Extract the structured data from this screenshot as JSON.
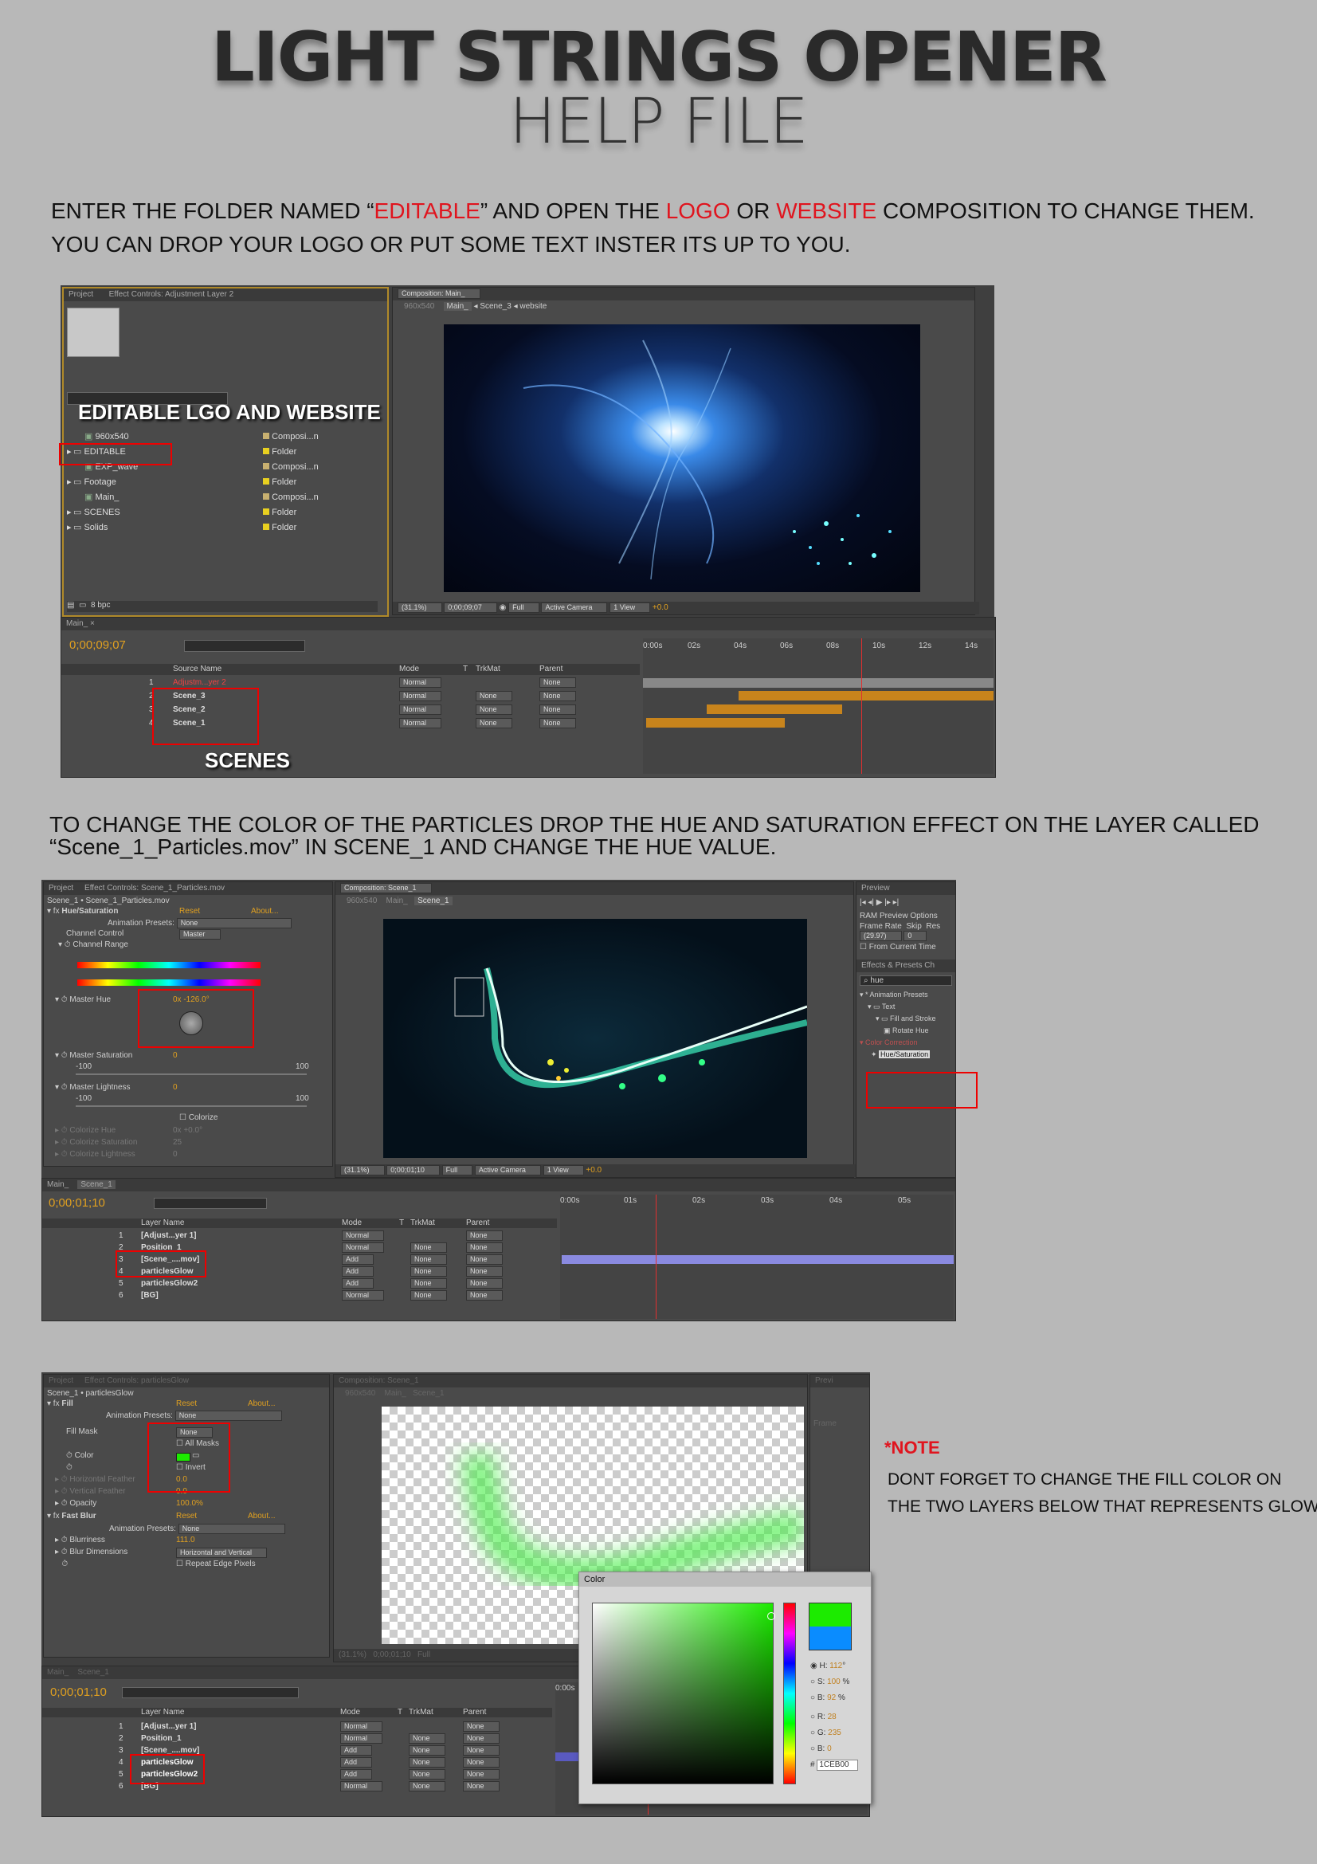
{
  "header": {
    "title": "LIGHT STRINGS OPENER",
    "subtitle": "HELP FILE"
  },
  "instructions": {
    "p1_line1": [
      "ENTER THE FOLDER NAMED “",
      "EDITABLE",
      "” AND OPEN THE  ",
      "LOGO",
      " OR ",
      "WEBSITE",
      " COMPOSITION TO CHANGE THEM."
    ],
    "p1_line2": "YOU CAN DROP YOUR LOGO OR PUT SOME TEXT INSTER ITS UP TO YOU.",
    "p2_line1": "TO CHANGE THE COLOR OF THE PARTICLES DROP THE HUE AND SATURATION EFFECT ON THE LAYER CALLED",
    "p2_line2": "“Scene_1_Particles.mov” IN SCENE_1 AND CHANGE THE HUE VALUE.",
    "note_title": "*NOTE",
    "note_line1": "DONT FORGET TO CHANGE THE FILL COLOR ON",
    "note_line2": "THE TWO LAYERS BELOW THAT REPRESENTS GLOW"
  },
  "shot1": {
    "tab_project": "Project",
    "tab_effect": "Effect Controls: Adjustment Layer 2",
    "overlay_label": "EDITABLE LGO AND WEBSITE",
    "items": [
      {
        "name": "960x540",
        "type": "Composi...n"
      },
      {
        "name": "EDITABLE",
        "type": "Folder"
      },
      {
        "name": "EXP_wave",
        "type": "Composi...n"
      },
      {
        "name": "Footage",
        "type": "Folder"
      },
      {
        "name": "Main_",
        "type": "Composi...n"
      },
      {
        "name": "SCENES",
        "type": "Folder"
      },
      {
        "name": "Solids",
        "type": "Folder"
      }
    ],
    "bpc": "8 bpc",
    "comp_tab": "Composition: Main_",
    "crumbs": [
      "960x540",
      "Main_",
      "Scene_3",
      "website"
    ],
    "zoom": "(31.1%)",
    "timecode_viewer": "0;00;09;07",
    "res": "Full",
    "camera": "Active Camera",
    "view": "1 View",
    "offset": "+0.0",
    "timeline_tab": "Main_",
    "timecode": "0;00;09;07",
    "col_source": "Source Name",
    "col_mode": "Mode",
    "col_t": "T",
    "col_trkmat": "TrkMat",
    "col_parent": "Parent",
    "layers": [
      {
        "num": "1",
        "name": "Adjustm...yer 2",
        "mode": "Normal",
        "trk": "",
        "parent": "None"
      },
      {
        "num": "2",
        "name": "Scene_3",
        "mode": "Normal",
        "trk": "None",
        "parent": "None"
      },
      {
        "num": "3",
        "name": "Scene_2",
        "mode": "Normal",
        "trk": "None",
        "parent": "None"
      },
      {
        "num": "4",
        "name": "Scene_1",
        "mode": "Normal",
        "trk": "None",
        "parent": "None"
      }
    ],
    "ruler": [
      "0:00s",
      "02s",
      "04s",
      "06s",
      "08s",
      "10s",
      "12s",
      "14s"
    ],
    "scenes_label": "SCENES"
  },
  "shot2": {
    "tab_project": "Project",
    "tab_effect": "Effect Controls: Scene_1_Particles.mov",
    "breadcrumb": "Scene_1 • Scene_1_Particles.mov",
    "fx_name": "Hue/Saturation",
    "reset": "Reset",
    "about": "About...",
    "anim_presets": "Animation Presets:",
    "anim_none": "None",
    "channel_control": "Channel Control",
    "channel_value": "Master",
    "channel_range": "Channel Range",
    "master_hue": "Master Hue",
    "master_hue_val": "0x -126.0°",
    "master_sat": "Master Saturation",
    "master_sat_val": "0",
    "master_light": "Master Lightness",
    "master_light_val": "0",
    "min": "-100",
    "max": "100",
    "colorize": "Colorize",
    "colorize_hue": "Colorize Hue",
    "colorize_hue_val": "0x +0.0°",
    "colorize_sat": "Colorize Saturation",
    "colorize_sat_val": "25",
    "colorize_light": "Colorize Lightness",
    "colorize_light_val": "0",
    "comp_tab": "Composition: Scene_1",
    "crumbs": [
      "960x540",
      "Main_",
      "Scene_1"
    ],
    "zoom": "(31.1%)",
    "timecode_viewer": "0;00;01;10",
    "res": "Full",
    "camera": "Active Camera",
    "view": "1 View",
    "offset": "+0.0",
    "preview_tab": "Preview",
    "ram_options": "RAM Preview Options",
    "frame_rate": "Frame Rate",
    "skip": "Skip",
    "res_label": "Res",
    "fr_val": "(29.97)",
    "skip_val": "0",
    "from_current": "From Current Time",
    "effects_tab": "Effects & Presets",
    "ch_tab": "Ch",
    "search_val": "hue",
    "ep_tree": [
      "* Animation Presets",
      "Text",
      "Fill and Stroke",
      "Rotate Hue",
      "Color Correction",
      "Hue/Saturation"
    ],
    "tl_tabs": [
      "Main_",
      "Scene_1"
    ],
    "timecode": "0;00;01;10",
    "col_layer": "Layer Name",
    "col_mode": "Mode",
    "col_t": "T",
    "col_trkmat": "TrkMat",
    "col_parent": "Parent",
    "layers": [
      {
        "num": "1",
        "name": "[Adjust...yer 1]",
        "mode": "Normal",
        "trk": "",
        "parent": "None"
      },
      {
        "num": "2",
        "name": "Position_1",
        "mode": "Normal",
        "trk": "None",
        "parent": "None"
      },
      {
        "num": "3",
        "name": "[Scene_....mov]",
        "mode": "Add",
        "trk": "None",
        "parent": "None"
      },
      {
        "num": "4",
        "name": "particlesGlow",
        "mode": "Add",
        "trk": "None",
        "parent": "None"
      },
      {
        "num": "5",
        "name": "particlesGlow2",
        "mode": "Add",
        "trk": "None",
        "parent": "None"
      },
      {
        "num": "6",
        "name": "[BG]",
        "mode": "Normal",
        "trk": "None",
        "parent": "None"
      }
    ],
    "ruler": [
      "0:00s",
      "01s",
      "02s",
      "03s",
      "04s",
      "05s"
    ]
  },
  "shot3": {
    "tab_project": "Project",
    "tab_effect": "Effect Controls: particlesGlow",
    "breadcrumb": "Scene_1 • particlesGlow",
    "fx_fill": "Fill",
    "reset": "Reset",
    "about": "About...",
    "anim_presets": "Animation Presets:",
    "anim_none": "None",
    "fill_mask": "Fill Mask",
    "fill_mask_val": "None",
    "all_masks": "All Masks",
    "color": "Color",
    "invert": "Invert",
    "horiz_feather": "Horizontal Feather",
    "horiz_feather_val": "0.0",
    "vert_feather": "Vertical Feather",
    "vert_feather_val": "0.0",
    "opacity": "Opacity",
    "opacity_val": "100.0%",
    "fx_blur": "Fast Blur",
    "blurriness": "Blurriness",
    "blurriness_val": "111.0",
    "blur_dims": "Blur Dimensions",
    "blur_dims_val": "Horizontal and Vertical",
    "repeat_edge": "Repeat Edge Pixels",
    "comp_tab": "Composition: Scene_1",
    "crumbs": [
      "960x540",
      "Main_",
      "Scene_1"
    ],
    "zoom": "(31.1%)",
    "timecode_viewer": "0;00;01;10",
    "res": "Full",
    "preview_tab": "Previ",
    "fr_label": "Frame",
    "tl_tabs": [
      "Main_",
      "Scene_1"
    ],
    "timecode": "0;00;01;10",
    "col_layer": "Layer Name",
    "col_mode": "Mode",
    "col_t": "T",
    "col_trkmat": "TrkMat",
    "col_parent": "Parent",
    "layers": [
      {
        "num": "1",
        "name": "[Adjust...yer 1]",
        "mode": "Normal",
        "trk": "",
        "parent": "None"
      },
      {
        "num": "2",
        "name": "Position_1",
        "mode": "Normal",
        "trk": "None",
        "parent": "None"
      },
      {
        "num": "3",
        "name": "[Scene_....mov]",
        "mode": "Add",
        "trk": "None",
        "parent": "None"
      },
      {
        "num": "4",
        "name": "particlesGlow",
        "mode": "Add",
        "trk": "None",
        "parent": "None"
      },
      {
        "num": "5",
        "name": "particlesGlow2",
        "mode": "Add",
        "trk": "None",
        "parent": "None"
      },
      {
        "num": "6",
        "name": "[BG]",
        "mode": "Normal",
        "trk": "None",
        "parent": "None"
      }
    ],
    "ruler_start": "0:00s",
    "color_dialog": {
      "title": "Color",
      "h_label": "H:",
      "h_val": "112",
      "h_unit": "°",
      "s_label": "S:",
      "s_val": "100",
      "s_unit": "%",
      "b_label": "B:",
      "b_val": "92",
      "b_unit": "%",
      "r_label": "R:",
      "r_val": "28",
      "g_label": "G:",
      "g_val": "235",
      "bb_label": "B:",
      "bb_val": "0",
      "hex_label": "#",
      "hex_val": "1CEB00",
      "new_color": "#1ceb00",
      "old_color": "#0a8cff"
    }
  },
  "colors": {
    "accent_red": "#e0141e",
    "bg": "#b8b8b8",
    "timecode_orange": "#e0a020"
  }
}
